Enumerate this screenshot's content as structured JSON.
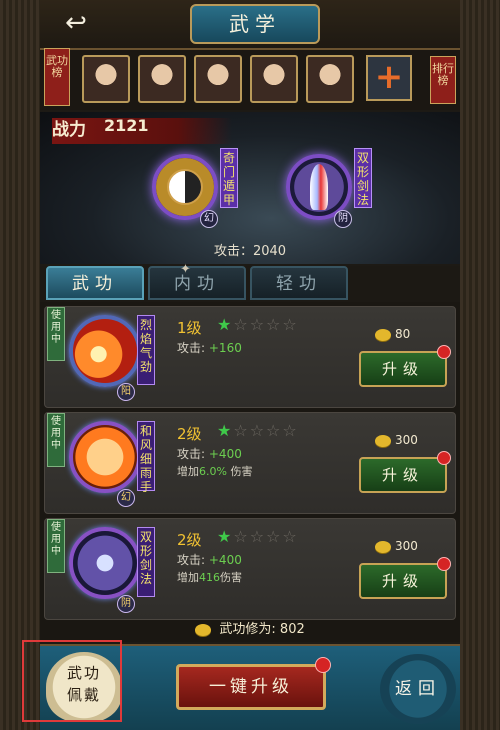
{
  "header": {
    "title": "武学",
    "back_icon": "back-arrow-icon"
  },
  "roster": {
    "left_tag": "武功榜",
    "right_tag": "排行榜",
    "add_label": "+"
  },
  "stage": {
    "power_label": "战力",
    "power_value": "2121",
    "slot1_name": "奇门遁甲",
    "slot1_badge": "幻",
    "slot2_name": "双形剑法",
    "slot2_badge": "阴",
    "attack_total": "攻击：2040"
  },
  "tabs": [
    {
      "label": "武功",
      "active": true
    },
    {
      "label": "内功",
      "active": false
    },
    {
      "label": "轻功",
      "active": false
    }
  ],
  "skills": [
    {
      "in_use": "使用中",
      "name": "烈焰气劲",
      "badge": "阳",
      "level": "1级",
      "attack_label": "攻击:",
      "attack_value": "+160",
      "bonus_prefix": "",
      "bonus_value": "",
      "bonus_suffix": "",
      "cost": "80",
      "upgrade_label": "升级",
      "stars_filled": 1,
      "stars_total": 5
    },
    {
      "in_use": "使用中",
      "name": "和风细雨手",
      "badge": "幻",
      "level": "2级",
      "attack_label": "攻击:",
      "attack_value": "+400",
      "bonus_prefix": "增加",
      "bonus_value": "6.0%",
      "bonus_suffix": "伤害",
      "cost": "300",
      "upgrade_label": "升级",
      "stars_filled": 1,
      "stars_total": 5
    },
    {
      "in_use": "使用中",
      "name": "双形剑法",
      "badge": "阴",
      "level": "2级",
      "attack_label": "攻击:",
      "attack_value": "+400",
      "bonus_prefix": "增加",
      "bonus_value": "416",
      "bonus_suffix": "伤害",
      "cost": "300",
      "upgrade_label": "升级",
      "stars_filled": 1,
      "stars_total": 5
    }
  ],
  "cultivation": "武功修为: 802",
  "footer": {
    "wear_label_1": "武功",
    "wear_label_2": "佩戴",
    "onekey_label": "一键升级",
    "back_label": "返回"
  }
}
